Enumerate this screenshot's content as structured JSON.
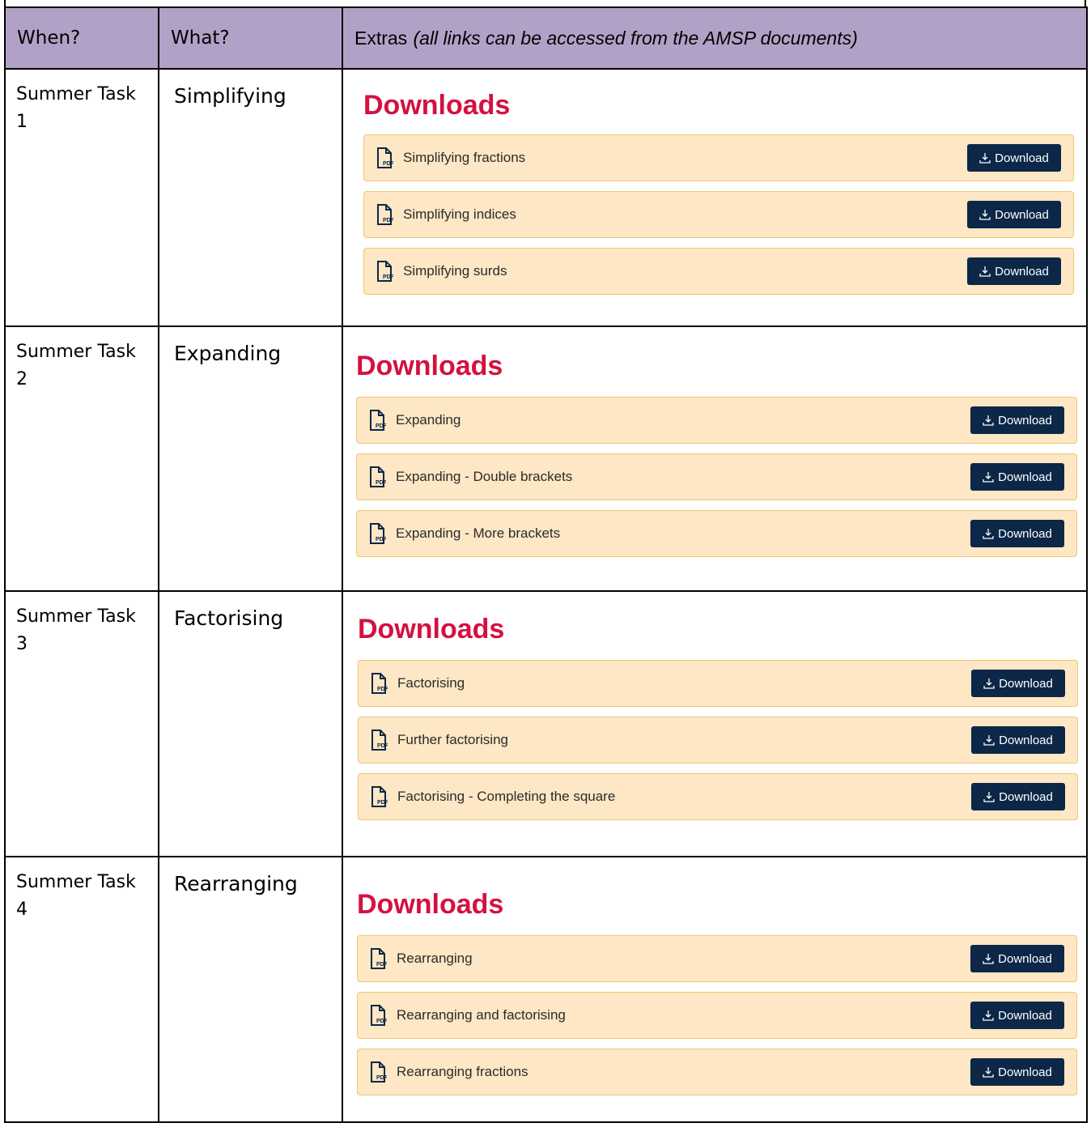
{
  "header": {
    "when": "When?",
    "what": "What?",
    "extras_main": "Extras",
    "extras_note": "(all links can be accessed from the AMSP documents)"
  },
  "download_button_label": "Download",
  "panel_heading": "Downloads",
  "icons": {
    "file": "pdf-file-icon",
    "download": "download-icon"
  },
  "colors": {
    "header_bg": "#b2a1c7",
    "heading_red": "#d4113f",
    "row_bg": "#fde7c4",
    "row_border": "#f2c66f",
    "button_bg": "#0c2747"
  },
  "rows": [
    {
      "when_line1": "Summer Task",
      "when_line2": "1",
      "what": "Simplifying",
      "files": [
        "Simplifying fractions",
        "Simplifying indices",
        "Simplifying surds"
      ]
    },
    {
      "when_line1": "Summer Task",
      "when_line2": "2",
      "what": "Expanding",
      "files": [
        "Expanding",
        "Expanding - Double brackets",
        "Expanding - More brackets"
      ]
    },
    {
      "when_line1": "Summer Task",
      "when_line2": "3",
      "what": "Factorising",
      "files": [
        "Factorising",
        "Further factorising",
        "Factorising - Completing the square"
      ]
    },
    {
      "when_line1": "Summer Task",
      "when_line2": "4",
      "what": "Rearranging",
      "files": [
        "Rearranging",
        "Rearranging and factorising",
        "Rearranging fractions"
      ]
    }
  ]
}
